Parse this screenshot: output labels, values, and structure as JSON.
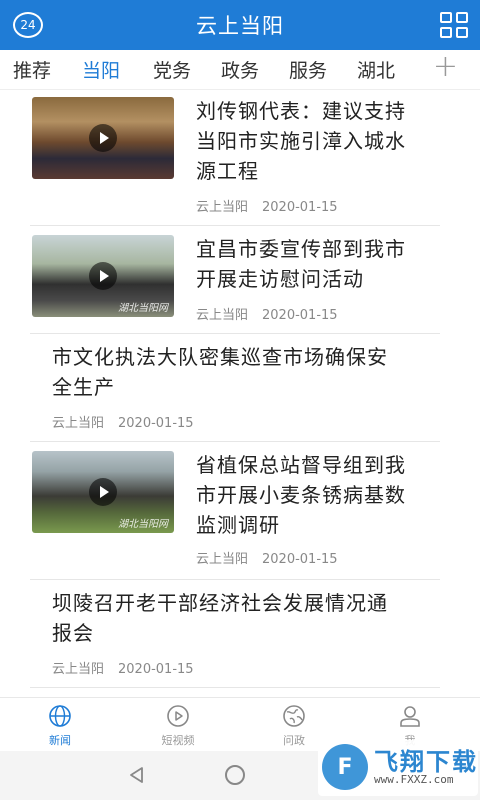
{
  "header": {
    "title": "云上当阳",
    "left_icon_text": "24"
  },
  "tabs": [
    {
      "label": "推荐",
      "active": false
    },
    {
      "label": "当阳",
      "active": true
    },
    {
      "label": "党务",
      "active": false
    },
    {
      "label": "政务",
      "active": false
    },
    {
      "label": "服务",
      "active": false
    },
    {
      "label": "湖北",
      "active": false
    }
  ],
  "tabs_add": "+",
  "feed": [
    {
      "title_lines": [
        "刘传钢代表：建议支持",
        "当阳市实施引漳入城水",
        "源工程"
      ],
      "source": "云上当阳",
      "date": "2020-01-15",
      "has_image": true,
      "video": true,
      "watermark": ""
    },
    {
      "title_lines": [
        "宜昌市委宣传部到我市",
        "开展走访慰问活动"
      ],
      "source": "云上当阳",
      "date": "2020-01-15",
      "has_image": true,
      "video": true,
      "watermark": "湖北当阳网"
    },
    {
      "title_lines": [
        "市文化执法大队密集巡查市场确保安",
        "全生产"
      ],
      "source": "云上当阳",
      "date": "2020-01-15",
      "has_image": false
    },
    {
      "title_lines": [
        "省植保总站督导组到我",
        "市开展小麦条锈病基数",
        "监测调研"
      ],
      "source": "云上当阳",
      "date": "2020-01-15",
      "has_image": true,
      "video": true,
      "watermark": "湖北当阳网"
    },
    {
      "title_lines": [
        "坝陵召开老干部经济社会发展情况通",
        "报会"
      ],
      "source": "云上当阳",
      "date": "2020-01-15",
      "has_image": false
    }
  ],
  "bottom_nav": [
    {
      "label": "新闻",
      "icon": "globe-icon",
      "active": true
    },
    {
      "label": "短视频",
      "icon": "play-circle-icon",
      "active": false
    },
    {
      "label": "问政",
      "icon": "earth-icon",
      "active": false
    },
    {
      "label": "我",
      "icon": "user-icon",
      "active": false
    }
  ],
  "watermark_logo": {
    "name": "飞翔下载",
    "url": "www.FXXZ.com",
    "mark": "F"
  },
  "colors": {
    "brand": "#1f7cd6",
    "text": "#222222",
    "meta": "#888888"
  }
}
